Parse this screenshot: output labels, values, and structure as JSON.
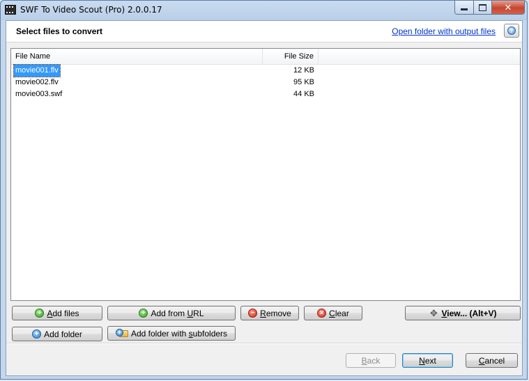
{
  "window": {
    "title": "SWF To Video Scout (Pro) 2.0.0.17",
    "close_glyph": "✕"
  },
  "header": {
    "title": "Select files to convert",
    "output_link": "Open folder with output files",
    "help_glyph": "?"
  },
  "file_list": {
    "columns": {
      "name": "File Name",
      "size": "File Size"
    },
    "rows": [
      {
        "name": "movie001.flv",
        "size": "12 KB",
        "selected": true
      },
      {
        "name": "movie002.flv",
        "size": "95 KB",
        "selected": false
      },
      {
        "name": "movie003.swf",
        "size": "44 KB",
        "selected": false
      }
    ]
  },
  "buttons": {
    "add_files": {
      "pre": "",
      "key": "A",
      "post": "dd files"
    },
    "add_url": {
      "pre": "Add from ",
      "key": "U",
      "post": "RL"
    },
    "remove": {
      "pre": "",
      "key": "R",
      "post": "emove"
    },
    "clear": {
      "pre": "",
      "key": "C",
      "post": "lear"
    },
    "view": {
      "pre": "",
      "key": "V",
      "post": "iew... (Alt+V)"
    },
    "add_folder": {
      "pre": "Add folder",
      "key": "",
      "post": ""
    },
    "add_folder_sub": {
      "pre": "Add folder with ",
      "key": "s",
      "post": "ubfolders"
    },
    "back": {
      "pre": "",
      "key": "B",
      "post": "ack",
      "disabled": true
    },
    "next": {
      "pre": "",
      "key": "N",
      "post": "ext"
    },
    "cancel": {
      "pre": "",
      "key": "C",
      "post": "ancel"
    }
  },
  "icons": {
    "plus": "+",
    "minus": "−",
    "clear": "×",
    "move": "✥"
  }
}
